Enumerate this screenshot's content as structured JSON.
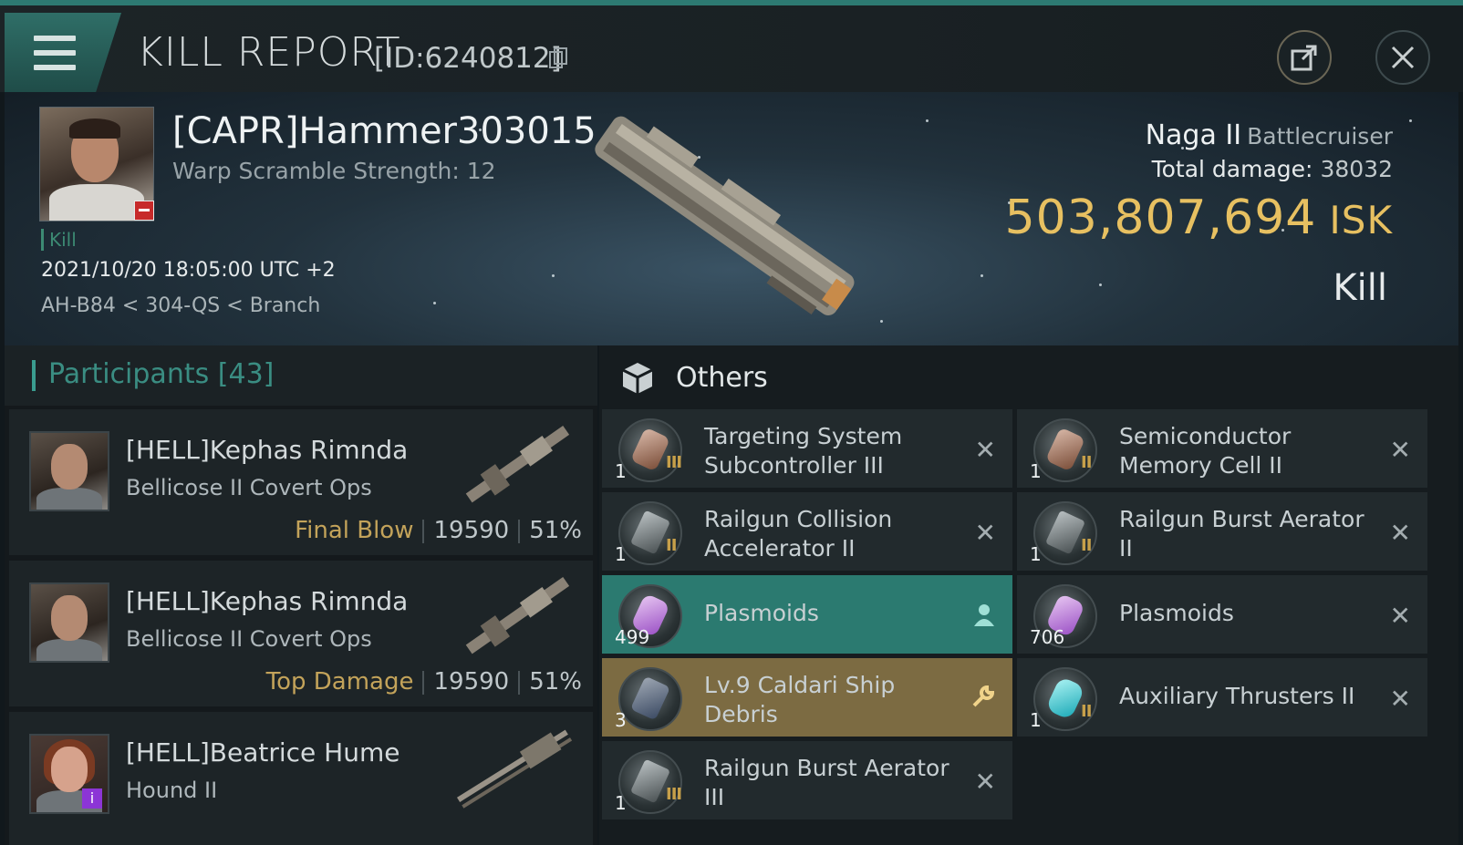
{
  "header": {
    "title": "KILL REPORT",
    "report_id": "[ID:6240812]"
  },
  "victim": {
    "pilot": "[CAPR]Hammer303015",
    "warp_scramble": "Warp Scramble Strength: 12",
    "tag": "Kill",
    "datetime": "2021/10/20 18:05:00 UTC +2",
    "location": "AH-B84 < 304-QS < Branch",
    "ship_name": "Naga II",
    "ship_class": "Battlecruiser",
    "total_damage_label": "Total damage:",
    "total_damage": "38032",
    "isk_value": "503,807,694",
    "isk_unit": "ISK",
    "result": "Kill"
  },
  "participants": {
    "title": "Participants",
    "count": "[43]",
    "rows": [
      {
        "name": "[HELL]Kephas Rimnda",
        "ship": "Bellicose II Covert Ops",
        "tag": "Final Blow",
        "damage": "19590",
        "percent": "51%"
      },
      {
        "name": "[HELL]Kephas Rimnda",
        "ship": "Bellicose II Covert Ops",
        "tag": "Top Damage",
        "damage": "19590",
        "percent": "51%"
      },
      {
        "name": "[HELL]Beatrice Hume",
        "ship": "Hound II",
        "tag": "",
        "damage": "",
        "percent": "",
        "badge": "i"
      }
    ]
  },
  "others": {
    "title": "Others",
    "items": [
      {
        "name": "Targeting System Subcontroller III",
        "qty": "1",
        "tier": "III",
        "state": "dropped-off",
        "icon": "subcontroller-icon"
      },
      {
        "name": "Semiconductor Memory Cell II",
        "qty": "1",
        "tier": "II",
        "state": "dropped-off",
        "icon": "memory-cell-icon"
      },
      {
        "name": "Railgun Collision Accelerator II",
        "qty": "1",
        "tier": "II",
        "state": "dropped-off",
        "icon": "railgun-rig-icon"
      },
      {
        "name": "Railgun Burst Aerator II",
        "qty": "1",
        "tier": "II",
        "state": "dropped-off",
        "icon": "railgun-rig-icon"
      },
      {
        "name": "Plasmoids",
        "qty": "499",
        "tier": "",
        "state": "dropped",
        "icon": "plasmoid-icon"
      },
      {
        "name": "Plasmoids",
        "qty": "706",
        "tier": "",
        "state": "dropped-off",
        "icon": "plasmoid-icon"
      },
      {
        "name": "Lv.9 Caldari Ship Debris",
        "qty": "3",
        "tier": "",
        "state": "salvage",
        "icon": "debris-icon"
      },
      {
        "name": "Auxiliary Thrusters II",
        "qty": "1",
        "tier": "II",
        "state": "dropped-off",
        "icon": "thruster-icon"
      },
      {
        "name": "Railgun Burst Aerator III",
        "qty": "1",
        "tier": "III",
        "state": "dropped-off",
        "icon": "railgun-rig-icon"
      }
    ]
  },
  "colors": {
    "accent": "#2d7a72",
    "isk_gold": "#e7c061",
    "dropped": "#2b7a70",
    "salvage": "#7c6b42"
  }
}
